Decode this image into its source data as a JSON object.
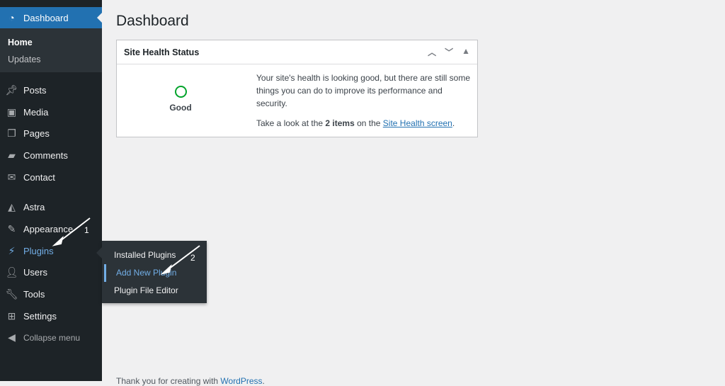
{
  "sidebar": {
    "dashboard": "Dashboard",
    "submenu": [
      "Home",
      "Updates"
    ],
    "items": [
      {
        "label": "Posts",
        "icon": "pin-icon"
      },
      {
        "label": "Media",
        "icon": "media-icon"
      },
      {
        "label": "Pages",
        "icon": "pages-icon"
      },
      {
        "label": "Comments",
        "icon": "comment-icon"
      },
      {
        "label": "Contact",
        "icon": "envelope-icon"
      },
      {
        "label": "Astra",
        "icon": "astra-icon"
      },
      {
        "label": "Appearance",
        "icon": "brush-icon"
      },
      {
        "label": "Plugins",
        "icon": "plug-icon"
      },
      {
        "label": "Users",
        "icon": "user-icon"
      },
      {
        "label": "Tools",
        "icon": "wrench-icon"
      },
      {
        "label": "Settings",
        "icon": "settings-icon"
      }
    ],
    "collapse": "Collapse menu"
  },
  "flyout": [
    "Installed Plugins",
    "Add New Plugin",
    "Plugin File Editor"
  ],
  "page_title": "Dashboard",
  "widget": {
    "title": "Site Health Status",
    "status": "Good",
    "text1": "Your site's health is looking good, but there are still some things you can do to improve its performance and security.",
    "text2_pre": "Take a look at the ",
    "text2_bold": "2 items",
    "text2_mid": " on the ",
    "text2_link": "Site Health screen",
    "text2_end": "."
  },
  "footer": {
    "pre": "Thank you for creating with ",
    "link": "WordPress",
    "end": "."
  },
  "annotations": [
    "1",
    "2"
  ]
}
